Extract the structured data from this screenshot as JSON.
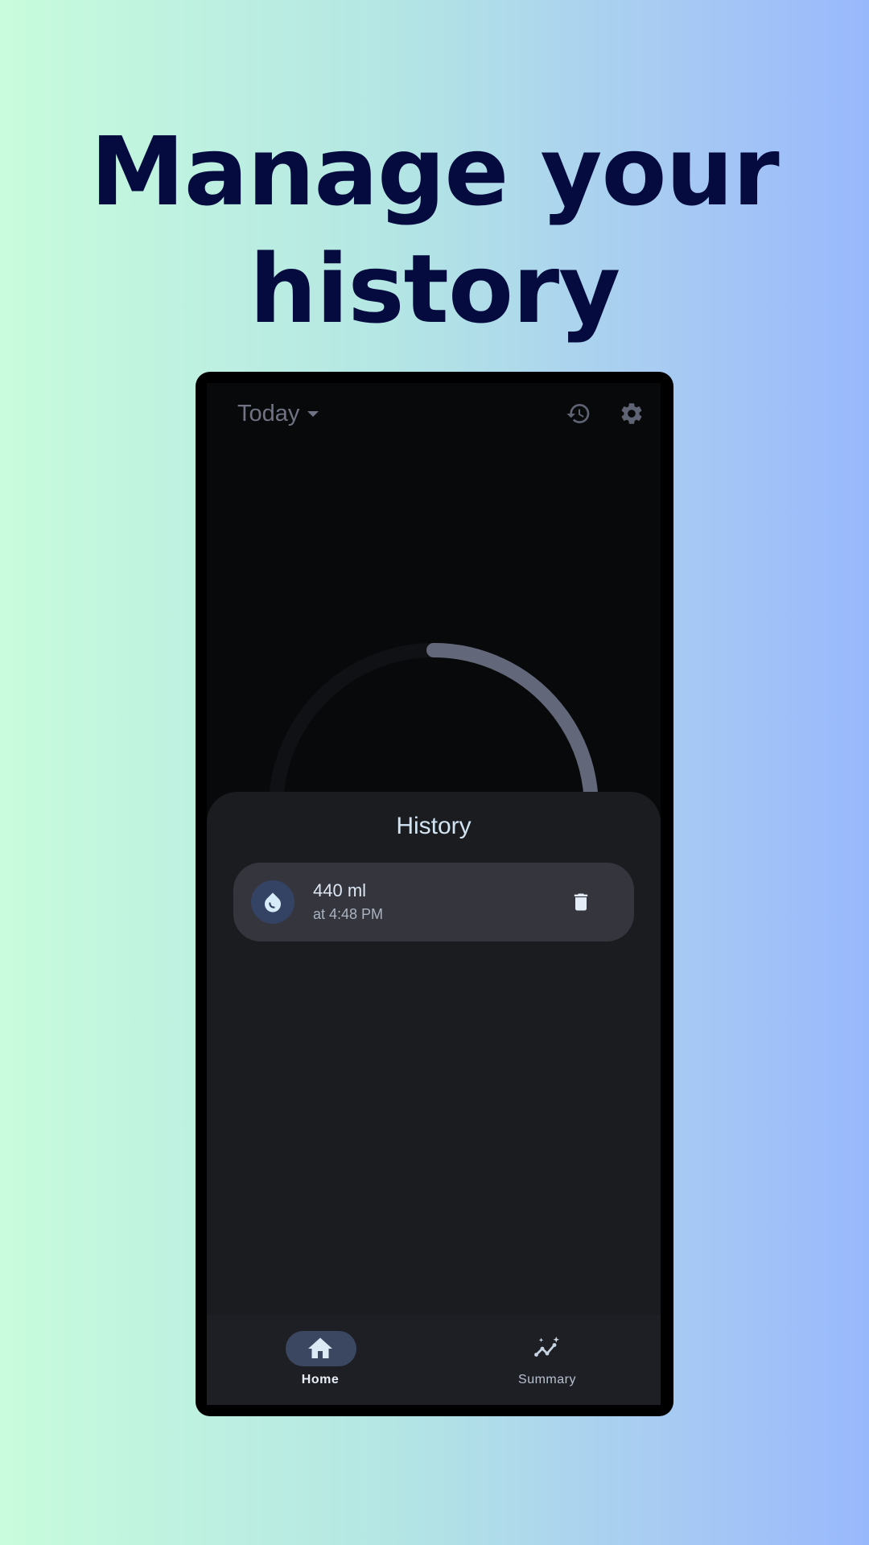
{
  "headline": {
    "line1": "Manage your",
    "line2": "history"
  },
  "topbar": {
    "date_selector": "Today",
    "date_selector_icon": "arrow-drop-down-icon",
    "history_icon": "history-icon",
    "settings_icon": "gear-icon"
  },
  "progress_ring": {
    "progress": 0.3,
    "track_color": "#101114",
    "fill_color": "#626779"
  },
  "history_sheet": {
    "title": "History",
    "entries": [
      {
        "icon": "water-drop-icon",
        "amount": "440 ml",
        "time": "at 4:48 PM",
        "action_icon": "delete-icon"
      }
    ]
  },
  "bottom_nav": {
    "items": [
      {
        "label": "Home",
        "icon": "home-icon",
        "active": true
      },
      {
        "label": "Summary",
        "icon": "insights-icon",
        "active": false
      }
    ]
  },
  "colors": {
    "headline": "#050b3e",
    "accent": "#a8e6f0",
    "sheet_bg": "#1b1c20",
    "card_bg": "#35363d"
  }
}
